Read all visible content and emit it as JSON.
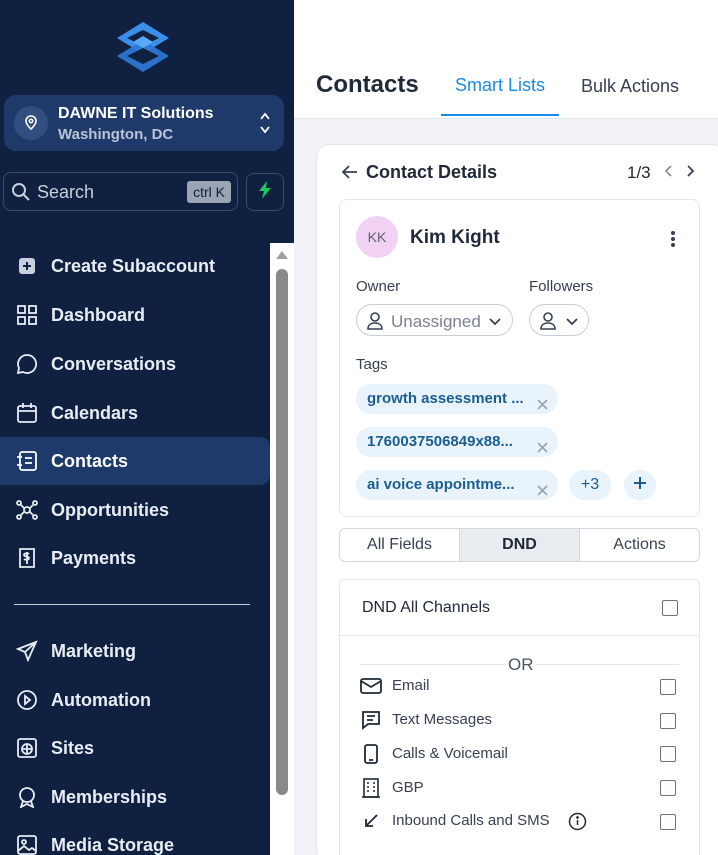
{
  "sidebar": {
    "account": {
      "name": "DAWNE IT Solutions",
      "location": "Washington, DC"
    },
    "search": {
      "placeholder": "Search",
      "shortcut": "ctrl K"
    },
    "items": [
      {
        "label": "Create Subaccount",
        "icon": "plus-square-icon"
      },
      {
        "label": "Dashboard",
        "icon": "grid-icon"
      },
      {
        "label": "Conversations",
        "icon": "chat-bubble-icon"
      },
      {
        "label": "Calendars",
        "icon": "calendar-icon"
      },
      {
        "label": "Contacts",
        "icon": "contact-book-icon",
        "active": true
      },
      {
        "label": "Opportunities",
        "icon": "opportunities-icon"
      },
      {
        "label": "Payments",
        "icon": "payments-icon"
      },
      {
        "label": "Marketing",
        "icon": "send-icon"
      },
      {
        "label": "Automation",
        "icon": "automation-icon"
      },
      {
        "label": "Sites",
        "icon": "globe-icon"
      },
      {
        "label": "Memberships",
        "icon": "badge-icon"
      },
      {
        "label": "Media Storage",
        "icon": "image-icon"
      }
    ],
    "colors": {
      "background": "#0f2040",
      "active": "#1d3a6b"
    }
  },
  "header": {
    "title": "Contacts",
    "tabs": [
      {
        "label": "Smart Lists",
        "active": true
      },
      {
        "label": "Bulk Actions"
      }
    ],
    "accent": "#1a8ae5"
  },
  "contact_panel": {
    "title": "Contact Details",
    "pagination": "1/3",
    "contact": {
      "initials": "KK",
      "name": "Kim Kight"
    },
    "owner_label": "Owner",
    "owner_value": "Unassigned",
    "followers_label": "Followers",
    "tags_label": "Tags",
    "tags": [
      "growth assessment ...",
      "1760037506849x88...",
      "ai voice appointme..."
    ],
    "more_tags": "+3",
    "section_tabs": [
      {
        "label": "All Fields"
      },
      {
        "label": "DND",
        "active": true
      },
      {
        "label": "Actions"
      }
    ],
    "dnd": {
      "all_channels": "DND All Channels",
      "or": "OR",
      "channels": [
        {
          "label": "Email",
          "icon": "mail-icon"
        },
        {
          "label": "Text Messages",
          "icon": "message-icon"
        },
        {
          "label": "Calls & Voicemail",
          "icon": "phone-icon"
        },
        {
          "label": "GBP",
          "icon": "building-icon"
        },
        {
          "label": "Inbound Calls and SMS",
          "icon": "inbound-arrow-icon"
        }
      ]
    }
  }
}
